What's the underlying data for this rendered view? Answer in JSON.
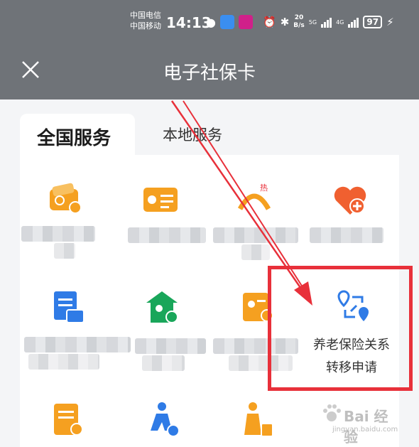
{
  "status_bar": {
    "carrier_1": "中国电信",
    "carrier_2": "中国移动",
    "time": "14:13",
    "speed_value": "20",
    "speed_unit": "B/s",
    "net_1": "5G",
    "net_2": "4G",
    "battery": "97"
  },
  "header": {
    "title": "电子社保卡",
    "close_icon": "close-icon"
  },
  "tabs": {
    "national": "全国服务",
    "local": "本地服务"
  },
  "services": {
    "highlighted_label_line1": "养老保险关系",
    "highlighted_label_line2": "转移申请"
  },
  "watermark": {
    "brand": "Bai 经验",
    "url": "jingyan.baidu.com"
  },
  "colors": {
    "header_bg": "#6f7378",
    "accent_orange": "#f5a020",
    "accent_blue": "#2f7be6",
    "highlight_red": "#e8303a"
  }
}
